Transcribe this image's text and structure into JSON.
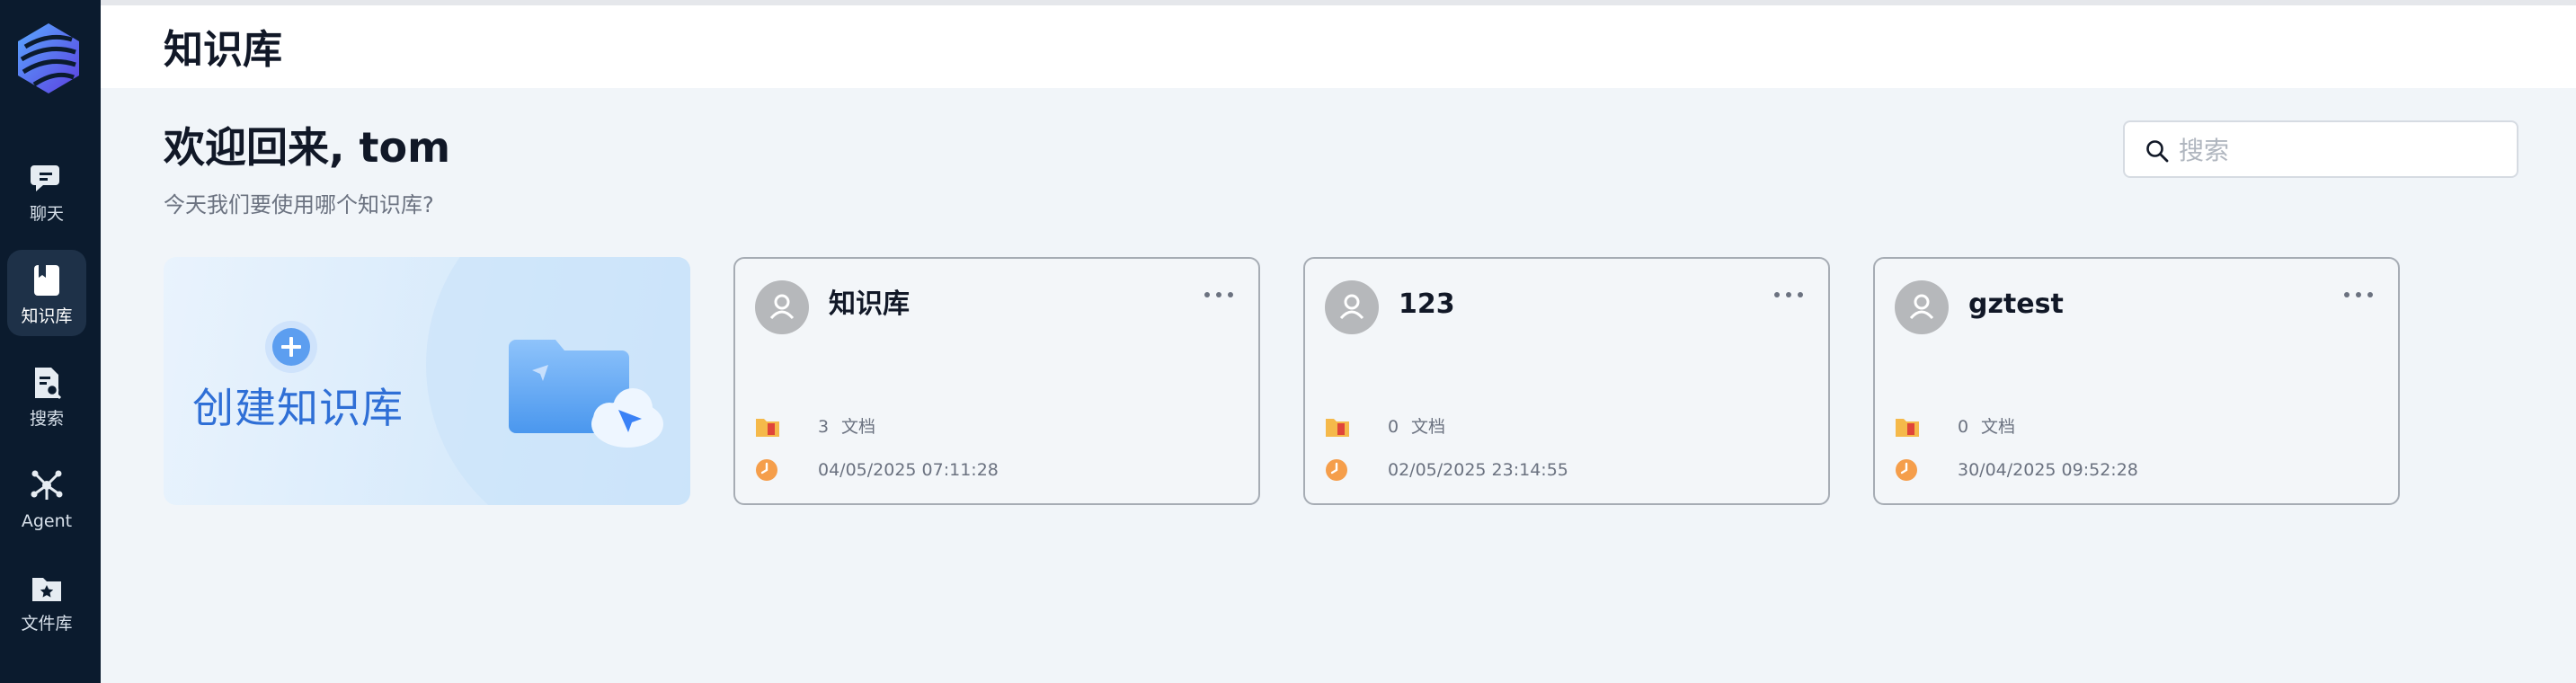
{
  "sidebar": {
    "items": [
      {
        "label": "聊天",
        "icon": "chat-icon"
      },
      {
        "label": "知识库",
        "icon": "knowledge-base-icon",
        "active": true
      },
      {
        "label": "搜索",
        "icon": "search-doc-icon"
      },
      {
        "label": "Agent",
        "icon": "agent-icon"
      },
      {
        "label": "文件库",
        "icon": "file-library-icon"
      }
    ]
  },
  "header": {
    "title": "知识库"
  },
  "main": {
    "welcome": "欢迎回来, tom",
    "subtitle": "今天我们要使用哪个知识库?",
    "search": {
      "placeholder": "搜索"
    },
    "create_card": {
      "label": "创建知识库"
    },
    "kb_cards": [
      {
        "name": "知识库",
        "doc_count": "3",
        "doc_label": "文档",
        "updated": "04/05/2025 07:11:28"
      },
      {
        "name": "123",
        "doc_count": "0",
        "doc_label": "文档",
        "updated": "02/05/2025 23:14:55"
      },
      {
        "name": "gztest",
        "doc_count": "0",
        "doc_label": "文档",
        "updated": "30/04/2025 09:52:28"
      }
    ]
  },
  "colors": {
    "sidebar_bg": "#0b1b2e",
    "accent_blue": "#2f6fd6",
    "page_bg": "#f1f5f9",
    "clock_orange": "#f59e4b"
  }
}
